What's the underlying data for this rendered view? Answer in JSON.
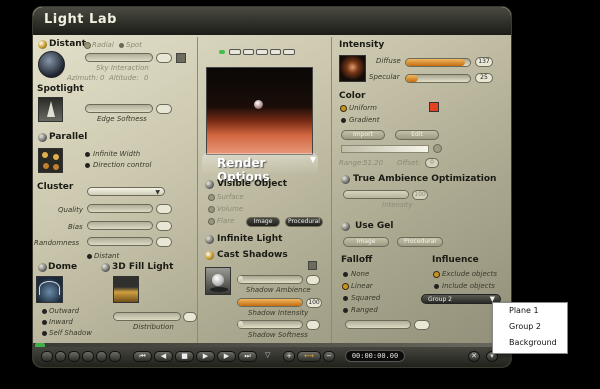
{
  "window": {
    "title": "Light Lab"
  },
  "distant": {
    "title": "Distant",
    "radial": "Radial",
    "spot": "Spot",
    "sky_interaction": "Sky Interaction",
    "azimuth_label": "Azimuth:",
    "azimuth_value": "0",
    "altitude_label": "Altitude:",
    "altitude_value": "0"
  },
  "spotlight": {
    "title": "Spotlight",
    "edge_softness": "Edge Softness"
  },
  "parallel": {
    "title": "Parallel",
    "infinite_width": "Infinite Width",
    "direction_control": "Direction control"
  },
  "cluster": {
    "title": "Cluster",
    "quality": "Quality",
    "bias": "Bias",
    "randomness": "Randomness",
    "distant": "Distant"
  },
  "dome": {
    "title": "Dome",
    "outward": "Outward",
    "inward": "Inward",
    "self_shadow": "Self Shadow"
  },
  "fill3d": {
    "title": "3D Fill Light",
    "distribution": "Distribution"
  },
  "center": {
    "render_options": "Render Options",
    "visible_object": "Visible Object",
    "surface": "Surface",
    "volume": "Volume",
    "flare": "Flare",
    "image_btn": "Image",
    "procedural_btn": "Procedural",
    "infinite_light": "Infinite Light",
    "cast_shadows": "Cast Shadows",
    "shadow_ambience": "Shadow Ambience",
    "shadow_intensity": "Shadow Intensity",
    "shadow_intensity_value": "100",
    "shadow_softness": "Shadow Softness"
  },
  "intensity": {
    "title": "Intensity",
    "diffuse": "Diffuse",
    "diffuse_value": "137",
    "diffuse_level": 0.92,
    "specular": "Specular",
    "specular_value": "25",
    "specular_level": 0.18
  },
  "color": {
    "title": "Color",
    "uniform": "Uniform",
    "gradient": "Gradient",
    "import_btn": "Import",
    "edit_btn": "Edit",
    "range_label": "Range:",
    "range_value": "51.20",
    "offset_label": "Offset:",
    "offset_value": "0",
    "swatch": "#e3411f"
  },
  "ambience": {
    "title": "True Ambience Optimization",
    "intensity": "Intensity",
    "value": "100"
  },
  "gel": {
    "title": "Use Gel",
    "image_btn": "Image",
    "procedural_btn": "Procedural"
  },
  "falloff": {
    "title": "Falloff",
    "none": "None",
    "linear": "Linear",
    "squared": "Squared",
    "ranged": "Ranged"
  },
  "influence": {
    "title": "Influence",
    "exclude": "Exclude objects",
    "include": "Include objects",
    "group_value": "Group 2"
  },
  "bottom": {
    "time": "00:00:00.00"
  },
  "dropdown": {
    "items": [
      "Plane 1",
      "Group 2",
      "Background"
    ]
  },
  "colors": {
    "accent": "#d9841f",
    "window_bg": "#c8c4aa"
  }
}
